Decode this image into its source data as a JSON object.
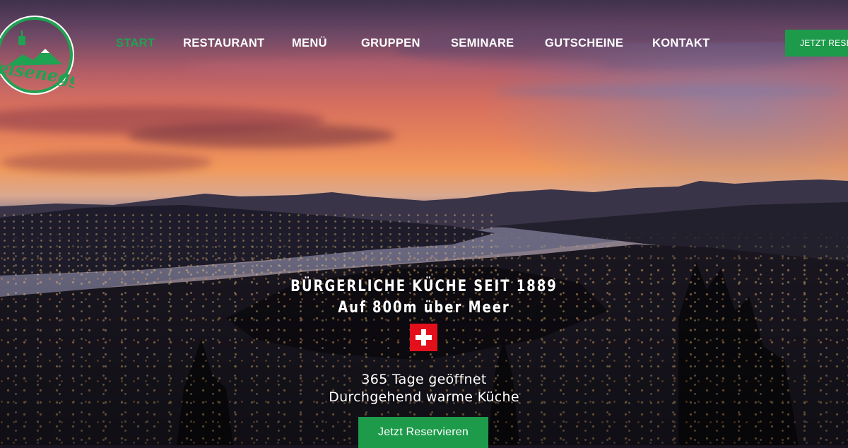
{
  "brand": {
    "logo_text": "Felsenegg",
    "accent_color": "#1fa251",
    "button_color": "#1d9b4b"
  },
  "nav": {
    "items": [
      {
        "label": "START",
        "active": true
      },
      {
        "label": "RESTAURANT",
        "active": false
      },
      {
        "label": "MENÜ",
        "active": false
      },
      {
        "label": "GRUPPEN",
        "active": false
      },
      {
        "label": "SEMINARE",
        "active": false
      },
      {
        "label": "GUTSCHEINE",
        "active": false
      },
      {
        "label": "KONTAKT",
        "active": false
      }
    ],
    "reserve_label": "JETZT RESERVIEREN"
  },
  "hero": {
    "headline": "BÜRGERLICHE KÜCHE SEIT 1889",
    "subheadline": "Auf 800m über Meer",
    "flag_icon": "swiss-flag-icon",
    "line1": "365 Tage geöffnet",
    "line2": "Durchgehend warme Küche",
    "cta_label": "Jetzt Reservieren"
  }
}
